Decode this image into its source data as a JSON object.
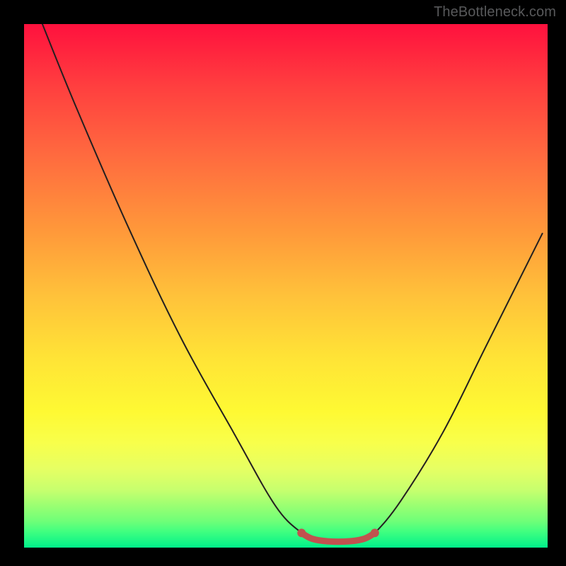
{
  "watermark": "TheBottleneck.com",
  "colors": {
    "curve_stroke": "#231F20",
    "marker_stroke": "#C1524F",
    "marker_fill": "#C1524F",
    "background": "#000000",
    "watermark": "#58595B"
  },
  "chart_data": {
    "type": "line",
    "title": "",
    "xlabel": "",
    "ylabel": "",
    "xlim": [
      0,
      100
    ],
    "ylim": [
      0,
      100
    ],
    "grid": false,
    "legend": false,
    "series": [
      {
        "name": "bottleneck-curve",
        "data": [
          {
            "x": 3.5,
            "y": 100
          },
          {
            "x": 10,
            "y": 84
          },
          {
            "x": 20,
            "y": 61
          },
          {
            "x": 30,
            "y": 40
          },
          {
            "x": 40,
            "y": 22
          },
          {
            "x": 48,
            "y": 8
          },
          {
            "x": 53,
            "y": 2.8
          },
          {
            "x": 55,
            "y": 1.7
          },
          {
            "x": 58,
            "y": 1.2
          },
          {
            "x": 62,
            "y": 1.2
          },
          {
            "x": 65,
            "y": 1.7
          },
          {
            "x": 67,
            "y": 2.8
          },
          {
            "x": 72,
            "y": 9
          },
          {
            "x": 80,
            "y": 22
          },
          {
            "x": 88,
            "y": 38
          },
          {
            "x": 96,
            "y": 54
          },
          {
            "x": 99,
            "y": 60
          }
        ]
      },
      {
        "name": "highlight-band",
        "data": [
          {
            "x": 53,
            "y": 2.8
          },
          {
            "x": 55,
            "y": 1.7
          },
          {
            "x": 58,
            "y": 1.2
          },
          {
            "x": 62,
            "y": 1.2
          },
          {
            "x": 65,
            "y": 1.7
          },
          {
            "x": 67,
            "y": 2.8
          }
        ]
      }
    ]
  }
}
